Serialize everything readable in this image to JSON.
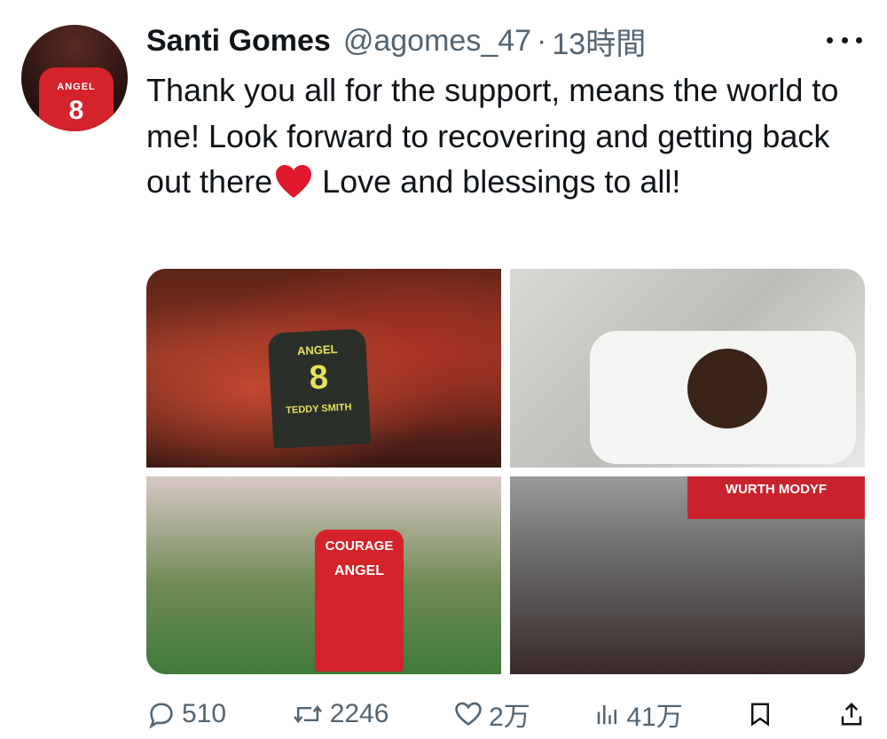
{
  "tweet": {
    "author": {
      "display_name": "Santi Gomes",
      "handle": "@agomes_47",
      "separator": "·",
      "time_ago": "13時間",
      "avatar": {
        "shirt_name": "ANGEL",
        "shirt_number": "8"
      }
    },
    "text_before_emoji": "Thank you all for the support, means the world to me! Look forward to recovering and getting back out there",
    "emoji": "red-heart",
    "text_after_emoji": "Love and blessings to all!",
    "media": [
      {
        "jersey_name": "ANGEL",
        "jersey_number": "8",
        "jersey_sub": "TEDDY SMITH"
      },
      {
        "description_icon": "hospital-photo"
      },
      {
        "jersey_top": "COURAGE",
        "jersey_name": "ANGEL"
      },
      {
        "banner": "WURTH MODYF"
      }
    ],
    "stats": {
      "replies": "510",
      "retweets": "2246",
      "likes": "2万",
      "views": "41万"
    }
  },
  "colors": {
    "text": "#0f1419",
    "secondary": "#536471",
    "heart": "#e0182b"
  }
}
